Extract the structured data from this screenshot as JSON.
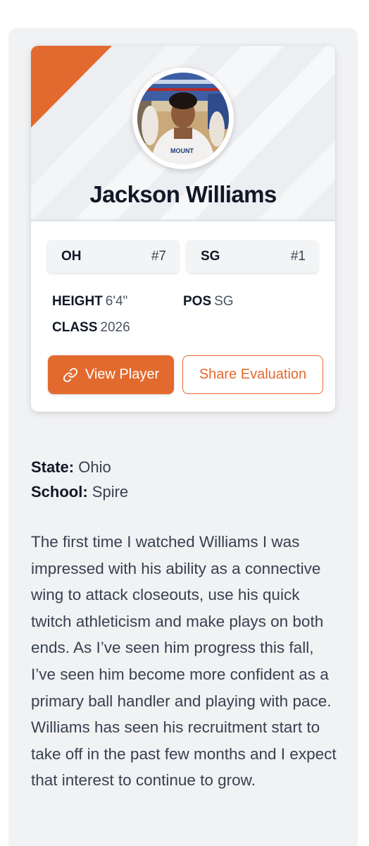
{
  "player": {
    "name": "Jackson Williams",
    "state_chip": {
      "label": "OH",
      "rank": "#7"
    },
    "position_chip": {
      "label": "SG",
      "rank": "#1"
    },
    "attributes": {
      "height_label": "HEIGHT",
      "height_value": "6'4\"",
      "position_label": "POS",
      "position_value": "SG",
      "class_label": "CLASS",
      "class_value": "2026"
    },
    "photo_jersey_text": "MOUNT"
  },
  "actions": {
    "view_player": "View Player",
    "share_evaluation": "Share Evaluation"
  },
  "details": {
    "state_label": "State:",
    "state_value": "Ohio",
    "school_label": "School:",
    "school_value": "Spire"
  },
  "evaluation": {
    "text": "The first time I watched Williams I was impressed with his ability as a connective wing to attack closeouts, use his quick twitch athleticism and make plays on both ends. As I’ve seen him progress this fall, I’ve seen him become more confident as a primary ball handler and playing with pace. Williams has seen his recruitment start to take off in the past few months and I expect that interest to continue to grow."
  },
  "colors": {
    "accent": "#e36a2e",
    "panel_bg": "#f1f2f3",
    "card_bg": "#ffffff",
    "text_dark": "#111827"
  },
  "icons": {
    "view_player": "link-icon"
  }
}
